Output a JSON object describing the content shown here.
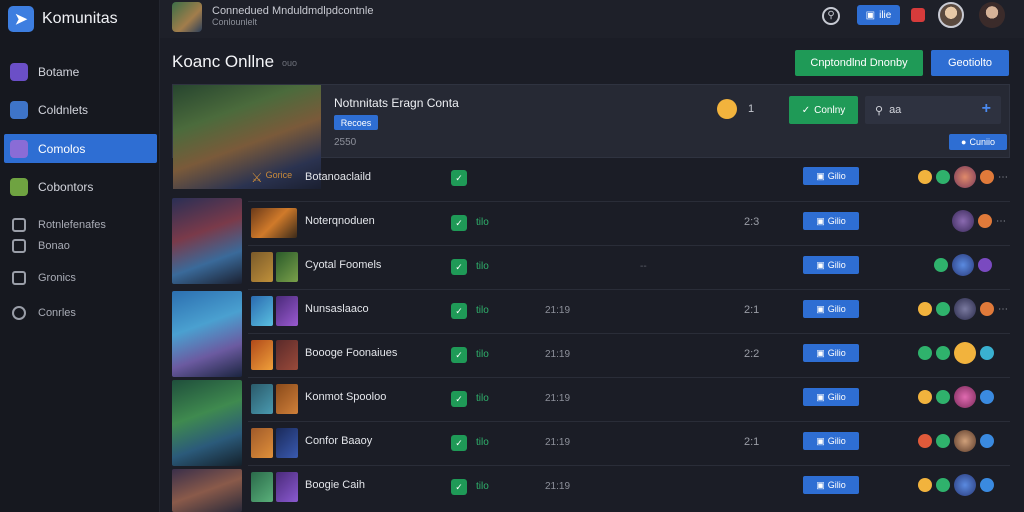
{
  "brand": {
    "name": "Komunitas"
  },
  "sidebar": {
    "items": [
      {
        "label": "Botame",
        "color": "#6b4fc7"
      },
      {
        "label": "Coldnlets",
        "color": "#3e74c8"
      },
      {
        "label": "Comolos",
        "color": "#8a6cd6"
      },
      {
        "label": "Cobontors",
        "color": "#6fa341"
      }
    ],
    "extra": [
      {
        "label": "Rotnlefenafes",
        "icon": "message-icon"
      },
      {
        "label": "Bonao",
        "icon": "grid-icon"
      },
      {
        "label": "Gronics",
        "icon": "image-icon"
      },
      {
        "label": "Conrles",
        "icon": "chat-icon"
      }
    ]
  },
  "topbar": {
    "title": "Connedued Mnduldmdlpdcontnle",
    "subtitle": "Conlounlelt",
    "button_label": "ilie"
  },
  "header": {
    "title": "Koanc Onllne",
    "tag": "ouo",
    "primary_button": "Cnptondlnd Dnonby",
    "secondary_button": "Geotiolto"
  },
  "featured": {
    "title": "Notnnitats Eragn Conta",
    "badge": "Recoes",
    "meta": "2550",
    "count": "1",
    "green_button": "Conlny",
    "search_value": "aa",
    "link_label": "Cuniio"
  },
  "rows": [
    {
      "name": "Botanoaclaild",
      "thumb_label": "Gorice",
      "value": "",
      "range": "",
      "num": "",
      "button": "Gilio"
    },
    {
      "name": "Noterqnoduen",
      "value": "tilo",
      "range": "",
      "num": "2:3",
      "button": "Gilio"
    },
    {
      "name": "Cyotal Foomels",
      "value": "tilo",
      "range": "",
      "num": "",
      "button": "Gilio"
    },
    {
      "name": "Nunsaslaaco",
      "value": "tilo",
      "range": "21:19",
      "num": "2:1",
      "button": "Gilio"
    },
    {
      "name": "Boooge Foonaiues",
      "value": "tilo",
      "range": "21:19",
      "num": "2:2",
      "button": "Gilio"
    },
    {
      "name": "Konmot Spooloo",
      "value": "tilo",
      "range": "21:19",
      "num": "",
      "button": "Gilio"
    },
    {
      "name": "Confor Baaoy",
      "value": "tilo",
      "range": "21:19",
      "num": "2:1",
      "button": "Gilio"
    },
    {
      "name": "Boogie Caih",
      "value": "tilo",
      "range": "21:19",
      "num": "",
      "button": "Gilio"
    }
  ],
  "dots": "--",
  "colors": {
    "accent_blue": "#2e6ed3",
    "accent_green": "#1f9a57",
    "background": "#1b1d26",
    "sidebar": "#16181f"
  }
}
